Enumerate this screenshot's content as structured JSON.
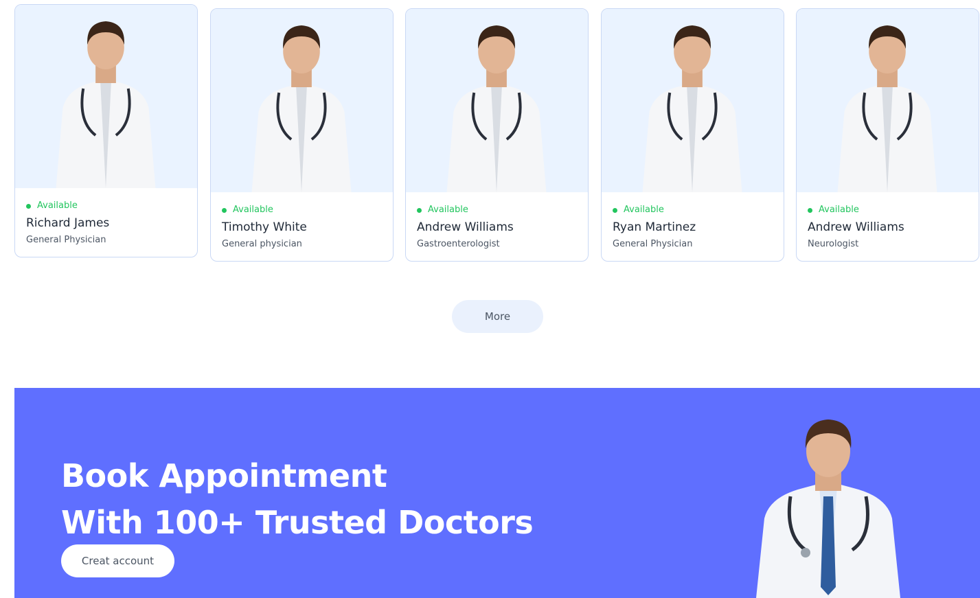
{
  "doctors": [
    {
      "status": "Available",
      "name": "Richard James",
      "speciality": "General Physician",
      "photo_icon": "doctor-photo"
    },
    {
      "status": "Available",
      "name": "Timothy White",
      "speciality": "General physician",
      "photo_icon": "doctor-photo"
    },
    {
      "status": "Available",
      "name": "Andrew Williams",
      "speciality": "Gastroenterologist",
      "photo_icon": "doctor-photo"
    },
    {
      "status": "Available",
      "name": "Ryan Martinez",
      "speciality": "General Physician",
      "photo_icon": "doctor-photo"
    },
    {
      "status": "Available",
      "name": "Andrew Williams",
      "speciality": "Neurologist",
      "photo_icon": "doctor-photo"
    }
  ],
  "more_button": "More",
  "banner": {
    "title_line1": "Book Appointment",
    "title_line2": "With 100+ Trusted Doctors",
    "cta": "Creat account"
  },
  "colors": {
    "accent": "#5f6fff",
    "available": "#22c55e",
    "card_photo_bg": "#eaf3ff",
    "card_border": "#c9d8f5"
  }
}
